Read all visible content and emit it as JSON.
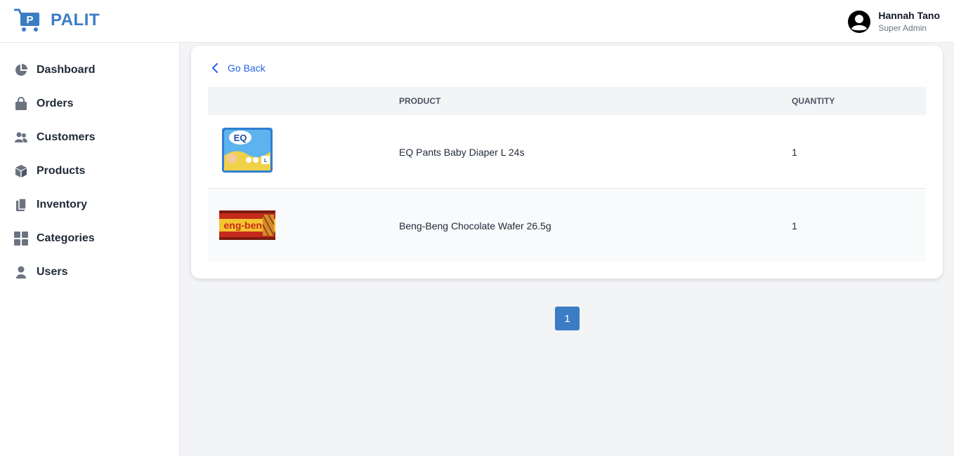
{
  "app": {
    "name": "PALIT"
  },
  "user": {
    "name": "Hannah Tano",
    "role": "Super Admin"
  },
  "sidebar": {
    "items": [
      {
        "label": "Dashboard",
        "icon": "pie-chart-icon"
      },
      {
        "label": "Orders",
        "icon": "shopping-bag-icon"
      },
      {
        "label": "Customers",
        "icon": "users-icon"
      },
      {
        "label": "Products",
        "icon": "cube-icon"
      },
      {
        "label": "Inventory",
        "icon": "clipboard-icon"
      },
      {
        "label": "Categories",
        "icon": "grid-icon"
      },
      {
        "label": "Users",
        "icon": "user-icon"
      }
    ]
  },
  "main": {
    "go_back_label": "Go Back",
    "table": {
      "headers": [
        "",
        "PRODUCT",
        "QUANTITY"
      ],
      "rows": [
        {
          "product": "EQ Pants Baby Diaper L 24s",
          "quantity": "1",
          "image": "diaper-pack-image"
        },
        {
          "product": "Beng-Beng Chocolate Wafer 26.5g",
          "quantity": "1",
          "image": "chocolate-wafer-image"
        }
      ]
    },
    "pagination": {
      "current_page": "1"
    }
  },
  "colors": {
    "brand": "#3b7dc4",
    "link": "#2563eb",
    "background": "#f3f4f6"
  }
}
